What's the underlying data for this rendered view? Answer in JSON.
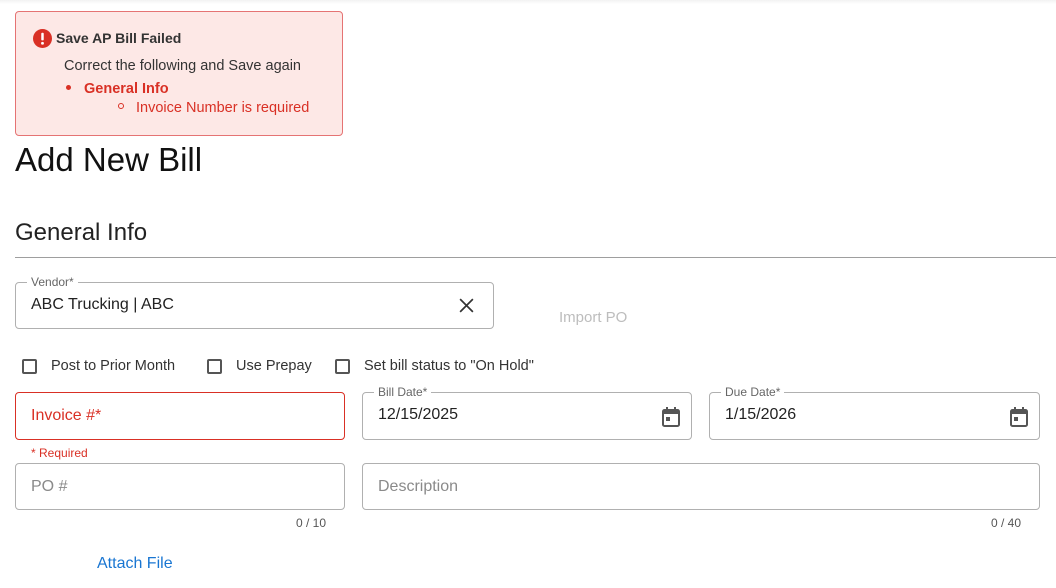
{
  "alert": {
    "title": "Save AP Bill Failed",
    "message": "Correct the following and Save again",
    "section": "General Info",
    "error_item": "Invoice Number is required",
    "icon": "error-icon",
    "color": "#d93025"
  },
  "page": {
    "title": "Add New Bill",
    "section_title": "General Info"
  },
  "vendor": {
    "label": "Vendor*",
    "value": "ABC Trucking | ABC",
    "clear_icon": "close-icon"
  },
  "import_po": "Import PO",
  "checkboxes": [
    {
      "label": "Post to Prior Month",
      "checked": false
    },
    {
      "label": "Use Prepay",
      "checked": false
    },
    {
      "label": "Set bill status to \"On Hold\"",
      "checked": false
    }
  ],
  "invoice": {
    "placeholder": "Invoice #*",
    "hint": "* Required"
  },
  "bill_date": {
    "label": "Bill Date*",
    "value": "12/15/2025",
    "icon": "calendar-icon"
  },
  "due_date": {
    "label": "Due Date*",
    "value": "1/15/2026",
    "icon": "calendar-icon"
  },
  "po": {
    "placeholder": "PO #",
    "counter": "0 / 10"
  },
  "description": {
    "placeholder": "Description",
    "counter": "0 / 40"
  },
  "attach_file": "Attach File",
  "colors": {
    "error": "#d93025",
    "link": "#1976d2",
    "alert_bg": "#fde8e6"
  }
}
